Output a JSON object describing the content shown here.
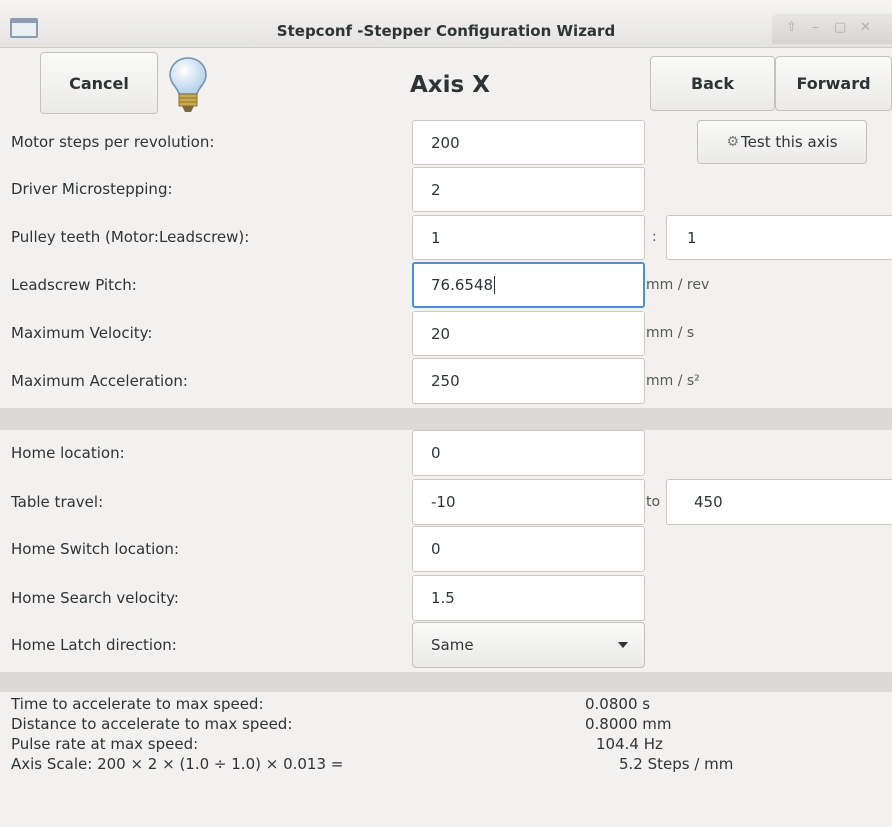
{
  "window": {
    "title": "Stepconf -Stepper Configuration Wizard",
    "controls": [
      "minimize-icon",
      "maximize-icon",
      "close-icon"
    ]
  },
  "header": {
    "cancel_label": "Cancel",
    "title": "Axis X",
    "back_label": "Back",
    "forward_label": "Forward",
    "help_icon": "lightbulb-icon"
  },
  "motor": {
    "steps_label": "Motor steps per revolution:",
    "steps_value": "200",
    "test_axis_label": "Test this axis",
    "microstep_label": "Driver Microstepping:",
    "microstep_value": "2",
    "pulley_label": "Pulley teeth (Motor:Leadscrew):",
    "pulley_motor": "1",
    "pulley_sep": ":",
    "pulley_leadscrew": "1",
    "pitch_label": "Leadscrew Pitch:",
    "pitch_value": "76.6548",
    "pitch_unit": "mm / rev",
    "velocity_label": "Maximum Velocity:",
    "velocity_value": "20",
    "velocity_unit": "mm / s",
    "accel_label": "Maximum Acceleration:",
    "accel_value": "250",
    "accel_unit": "mm / s²"
  },
  "homing": {
    "home_loc_label": "Home location:",
    "home_loc_value": "0",
    "travel_label": "Table travel:",
    "travel_min": "-10",
    "travel_to": "to",
    "travel_max": "450",
    "switch_label": "Home Switch location:",
    "switch_value": "0",
    "search_vel_label": "Home Search velocity:",
    "search_vel_value": "1.5",
    "latch_label": "Home Latch direction:",
    "latch_value": "Same"
  },
  "info": {
    "accel_time_label": "Time to accelerate to max speed:",
    "accel_time_value": "0.0800 s",
    "accel_dist_label": "Distance to accelerate to max speed:",
    "accel_dist_value": "0.8000 mm",
    "pulse_label": "Pulse rate at max speed:",
    "pulse_value": "104.4 Hz",
    "scale_label": "Axis Scale: 200 × 2 × (1.0 ÷ 1.0) × 0.013 =",
    "scale_value": "5.2 Steps / mm"
  },
  "colors": {
    "background": "#f2f1f0",
    "focus_border": "#4a90d9"
  }
}
